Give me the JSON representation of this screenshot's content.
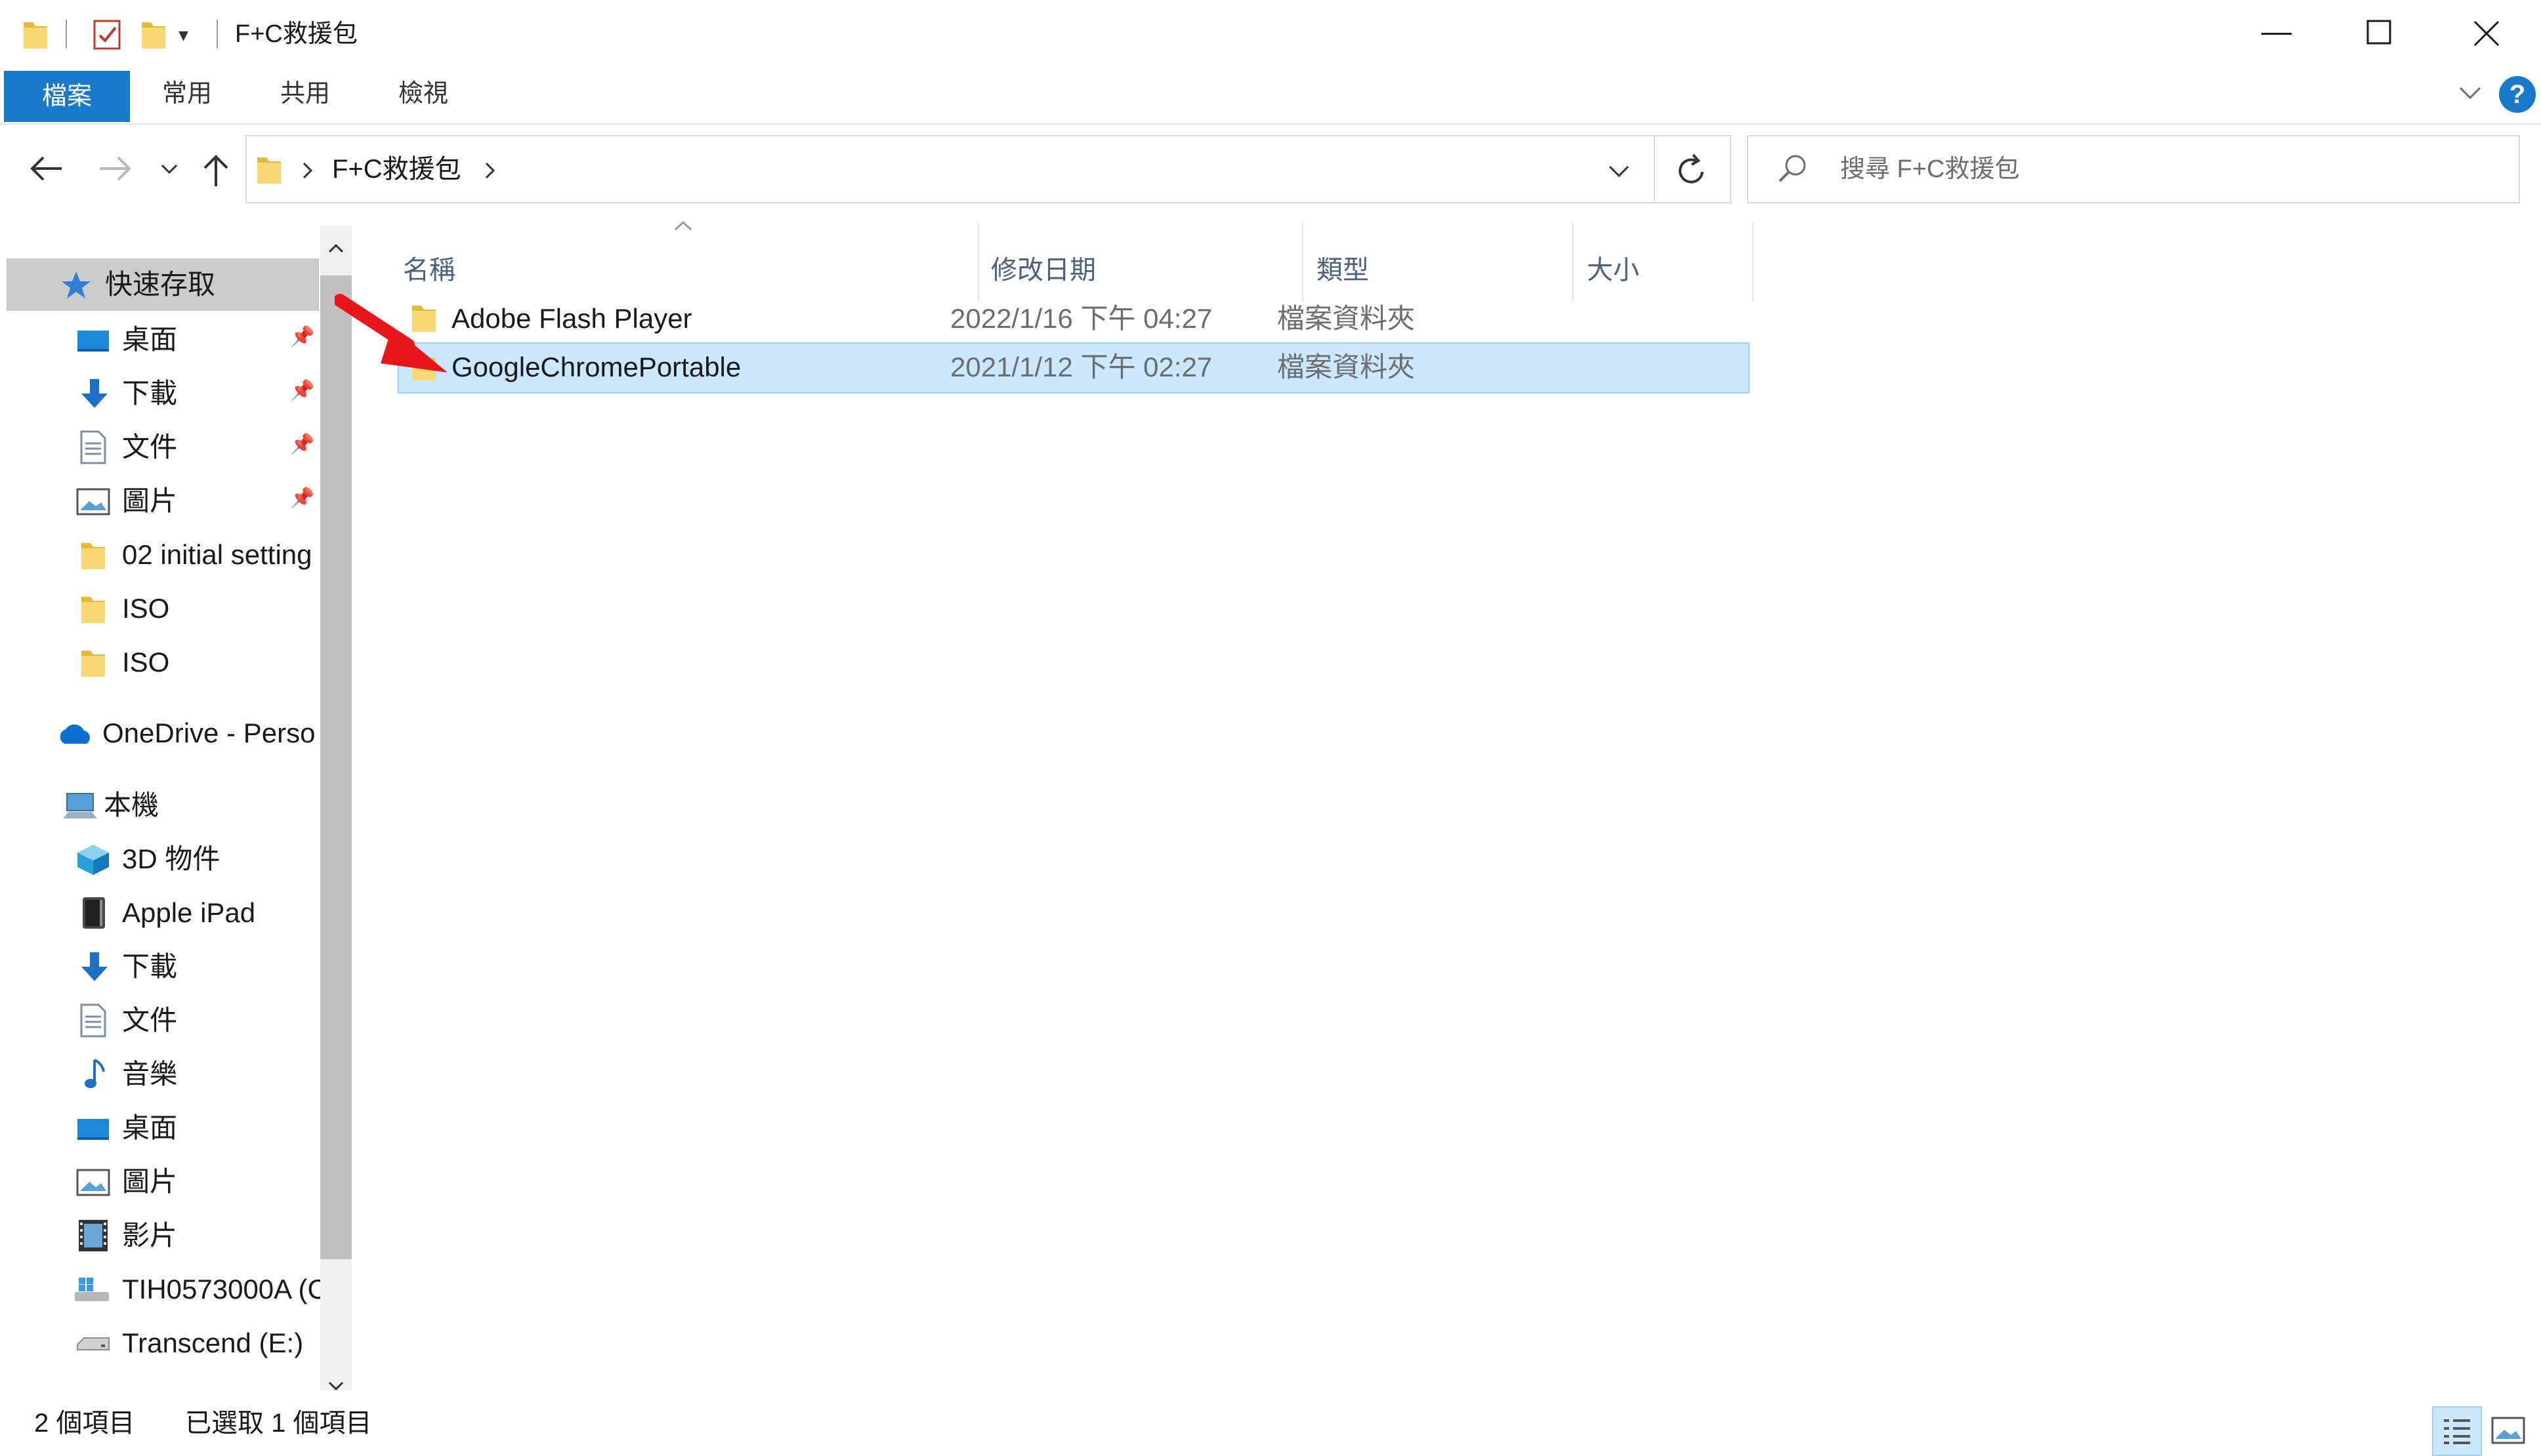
{
  "window": {
    "title": "F+C救援包",
    "qat_dropdown": "▾"
  },
  "ribbon": {
    "tabs": [
      {
        "label": "檔案"
      },
      {
        "label": "常用"
      },
      {
        "label": "共用"
      },
      {
        "label": "檢視"
      }
    ],
    "help": "?"
  },
  "nav": {
    "breadcrumb": [
      "F+C救援包"
    ],
    "search_placeholder": "搜尋 F+C救援包"
  },
  "navpane": {
    "quick_access": {
      "label": "快速存取",
      "items": [
        {
          "label": "桌面",
          "icon": "desktop-icon",
          "pinned": true
        },
        {
          "label": "下載",
          "icon": "download-icon",
          "pinned": true
        },
        {
          "label": "文件",
          "icon": "document-icon",
          "pinned": true
        },
        {
          "label": "圖片",
          "icon": "pictures-icon",
          "pinned": true
        },
        {
          "label": "02 initial setting",
          "icon": "folder-icon"
        },
        {
          "label": "ISO",
          "icon": "folder-icon"
        },
        {
          "label": "ISO",
          "icon": "folder-icon"
        }
      ]
    },
    "onedrive": {
      "label": "OneDrive - Perso"
    },
    "this_pc": {
      "label": "本機",
      "items": [
        {
          "label": "3D 物件",
          "icon": "3d-objects-icon"
        },
        {
          "label": "Apple iPad",
          "icon": "ipad-icon"
        },
        {
          "label": "下載",
          "icon": "download-icon"
        },
        {
          "label": "文件",
          "icon": "document-icon"
        },
        {
          "label": "音樂",
          "icon": "music-icon"
        },
        {
          "label": "桌面",
          "icon": "desktop-icon"
        },
        {
          "label": "圖片",
          "icon": "pictures-icon"
        },
        {
          "label": "影片",
          "icon": "video-icon"
        },
        {
          "label": "TIH0573000A (C",
          "icon": "windows-drive-icon"
        },
        {
          "label": "Transcend (E:)",
          "icon": "usb-drive-icon"
        }
      ]
    }
  },
  "filelist": {
    "columns": [
      "名稱",
      "修改日期",
      "類型",
      "大小"
    ],
    "rows": [
      {
        "name": "Adobe Flash Player",
        "modified": "2022/1/16 下午 04:27",
        "type": "檔案資料夾",
        "size": "",
        "selected": false
      },
      {
        "name": "GoogleChromePortable",
        "modified": "2021/1/12 下午 02:27",
        "type": "檔案資料夾",
        "size": "",
        "selected": true
      }
    ]
  },
  "status": {
    "count": "2 個項目",
    "selected": "已選取 1 個項目"
  },
  "colors": {
    "accent": "#1979ca",
    "selection_bg": "#cce8ff",
    "selection_border": "#99d1ff",
    "folder": "#f8d775",
    "annotation_arrow": "#e8161b"
  }
}
